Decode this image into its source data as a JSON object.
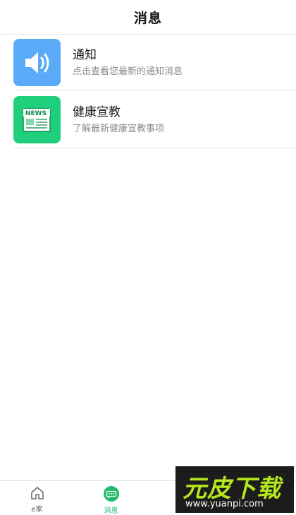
{
  "header": {
    "title": "消息"
  },
  "list": [
    {
      "title": "通知",
      "subtitle": "点击查看您最新的通知消息",
      "icon": "speaker-icon",
      "color": "#5aaaf8"
    },
    {
      "title": "健康宣教",
      "subtitle": "了解最新健康宣教事项",
      "icon": "news-icon",
      "color": "#1fcf7c",
      "icon_text": "NEWS"
    }
  ],
  "tabs": [
    {
      "label": "e家",
      "icon": "home-icon",
      "active": false
    },
    {
      "label": "消息",
      "icon": "chat-bubble-icon",
      "active": true
    },
    {
      "label": "",
      "icon": "hidden-tab",
      "active": false
    },
    {
      "label": "",
      "icon": "hidden-tab",
      "active": false
    }
  ],
  "colors": {
    "active_tab": "#1fba6c",
    "notification_icon_bg": "#5aaaf8",
    "news_icon_bg": "#1fcf7c"
  },
  "watermark": {
    "brand": "元皮下载",
    "url": "www.yuanpi.com"
  }
}
